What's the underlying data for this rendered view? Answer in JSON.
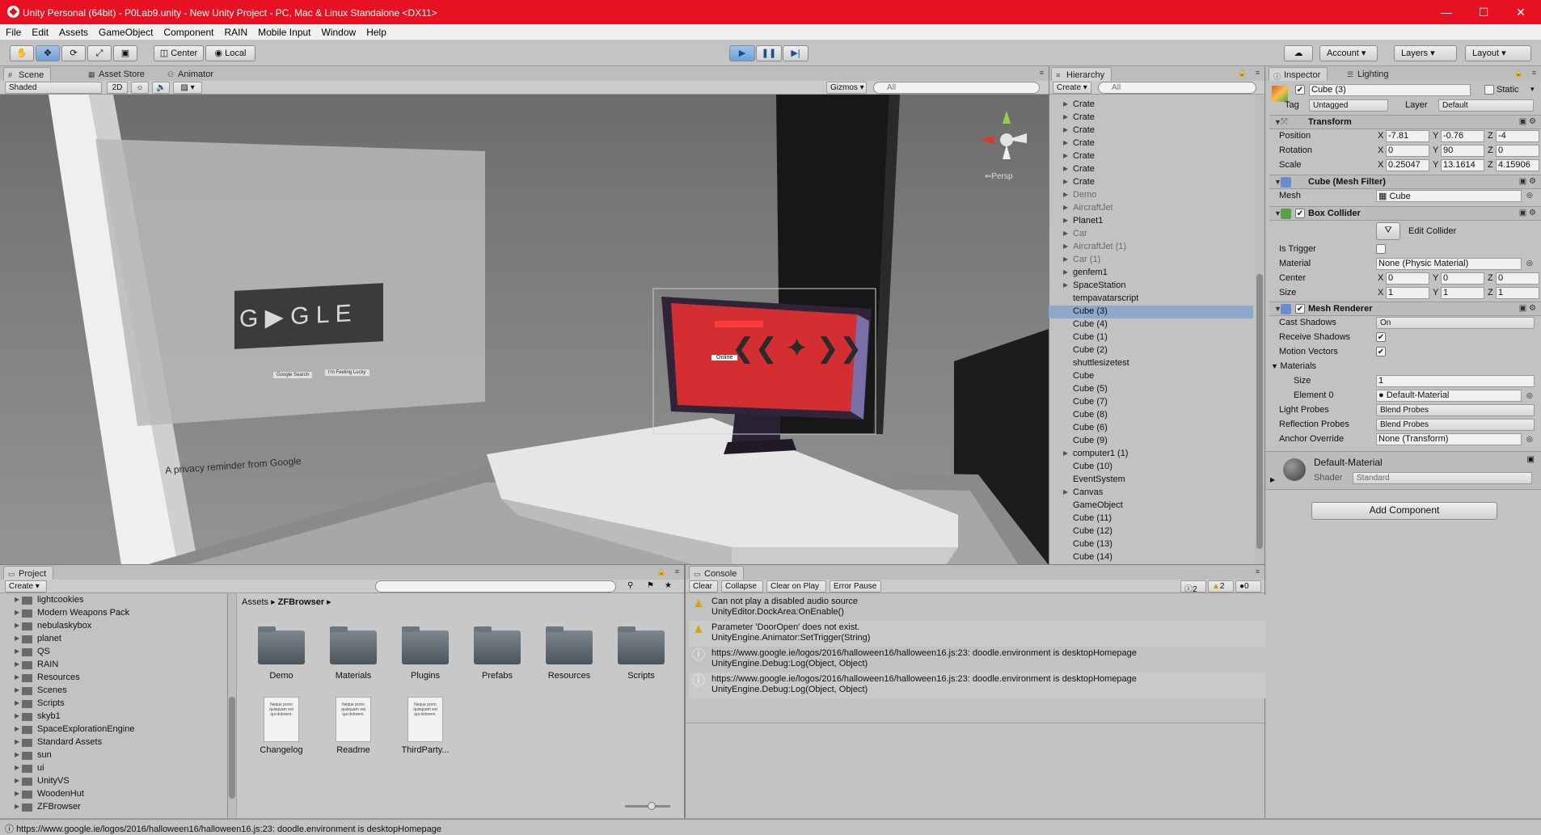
{
  "window": {
    "title": "Unity Personal (64bit) - P0Lab9.unity - New Unity Project - PC, Mac & Linux Standalone <DX11>",
    "controls": [
      "—",
      "☐",
      "✕"
    ]
  },
  "menu": [
    "File",
    "Edit",
    "Assets",
    "GameObject",
    "Component",
    "RAIN",
    "Mobile Input",
    "Window",
    "Help"
  ],
  "toolbar": {
    "pivot": "Center",
    "space": "Local",
    "account": "Account",
    "layers": "Layers",
    "layout": "Layout"
  },
  "scene": {
    "tabs": [
      "Scene",
      "Asset Store",
      "Animator"
    ],
    "shading": "Shaded",
    "mode2d": "2D",
    "gizmos": "Gizmos",
    "search_placeholder": "All",
    "persp": "Persp",
    "browser": {
      "privacy": "A privacy reminder from Google",
      "btn1": "Google Search",
      "btn2": "I'm Feeling Lucky"
    },
    "monitor": {
      "label": "Online"
    }
  },
  "hierarchy": {
    "tab": "Hierarchy",
    "create": "Create",
    "search_placeholder": "All",
    "items": [
      {
        "label": "Crate",
        "grey": false,
        "arrow": true
      },
      {
        "label": "Crate",
        "grey": false,
        "arrow": true
      },
      {
        "label": "Crate",
        "grey": false,
        "arrow": true
      },
      {
        "label": "Crate",
        "grey": false,
        "arrow": true
      },
      {
        "label": "Crate",
        "grey": false,
        "arrow": true
      },
      {
        "label": "Crate",
        "grey": false,
        "arrow": true
      },
      {
        "label": "Crate",
        "grey": false,
        "arrow": true
      },
      {
        "label": "Demo",
        "grey": true,
        "arrow": true
      },
      {
        "label": "AircraftJet",
        "grey": true,
        "arrow": true
      },
      {
        "label": "Planet1",
        "grey": false,
        "arrow": true
      },
      {
        "label": "Car",
        "grey": true,
        "arrow": true
      },
      {
        "label": "AircraftJet (1)",
        "grey": true,
        "arrow": true
      },
      {
        "label": "Car (1)",
        "grey": true,
        "arrow": true
      },
      {
        "label": "genfem1",
        "grey": false,
        "arrow": true
      },
      {
        "label": "SpaceStation",
        "grey": false,
        "arrow": true
      },
      {
        "label": "tempavatarscript",
        "grey": false,
        "arrow": false
      },
      {
        "label": "Cube (3)",
        "grey": false,
        "arrow": false
      },
      {
        "label": "Cube (4)",
        "grey": false,
        "arrow": false
      },
      {
        "label": "Cube (1)",
        "grey": false,
        "arrow": false
      },
      {
        "label": "Cube (2)",
        "grey": false,
        "arrow": false
      },
      {
        "label": "shuttlesizetest",
        "grey": false,
        "arrow": false
      },
      {
        "label": "Cube",
        "grey": false,
        "arrow": false
      },
      {
        "label": "Cube (5)",
        "grey": false,
        "arrow": false
      },
      {
        "label": "Cube (7)",
        "grey": false,
        "arrow": false
      },
      {
        "label": "Cube (8)",
        "grey": false,
        "arrow": false
      },
      {
        "label": "Cube (6)",
        "grey": false,
        "arrow": false
      },
      {
        "label": "Cube (9)",
        "grey": false,
        "arrow": false
      },
      {
        "label": "computer1 (1)",
        "grey": false,
        "arrow": true
      },
      {
        "label": "Cube (10)",
        "grey": false,
        "arrow": false
      },
      {
        "label": "EventSystem",
        "grey": false,
        "arrow": false
      },
      {
        "label": "Canvas",
        "grey": false,
        "arrow": true
      },
      {
        "label": "GameObject",
        "grey": false,
        "arrow": false
      },
      {
        "label": "Cube (11)",
        "grey": false,
        "arrow": false
      },
      {
        "label": "Cube (12)",
        "grey": false,
        "arrow": false
      },
      {
        "label": "Cube (13)",
        "grey": false,
        "arrow": false
      },
      {
        "label": "Cube (14)",
        "grey": false,
        "arrow": false
      }
    ]
  },
  "inspector": {
    "tabs": [
      "Inspector",
      "Lighting"
    ],
    "object_name": "Cube (3)",
    "static_label": "Static",
    "tag_label": "Tag",
    "tag_value": "Untagged",
    "layer_label": "Layer",
    "layer_value": "Default",
    "transform": {
      "title": "Transform",
      "position_label": "Position",
      "rotation_label": "Rotation",
      "scale_label": "Scale",
      "position": [
        "-7.81",
        "-0.76",
        "-4"
      ],
      "rotation": [
        "0",
        "90",
        "0"
      ],
      "scale": [
        "0.25047",
        "13.1614",
        "4.15906"
      ]
    },
    "mesh_filter": {
      "title": "Cube (Mesh Filter)",
      "mesh_label": "Mesh",
      "mesh_value": "Cube"
    },
    "box_collider": {
      "title": "Box Collider",
      "edit_label": "Edit Collider",
      "trigger_label": "Is Trigger",
      "material_label": "Material",
      "material_value": "None (Physic Material)",
      "center_label": "Center",
      "center": [
        "0",
        "0",
        "0"
      ],
      "size_label": "Size",
      "size": [
        "1",
        "1",
        "1"
      ]
    },
    "mesh_renderer": {
      "title": "Mesh Renderer",
      "cast_label": "Cast Shadows",
      "cast_value": "On",
      "receive_label": "Receive Shadows",
      "motion_label": "Motion Vectors",
      "materials_label": "Materials",
      "size_label": "Size",
      "size_value": "1",
      "element_label": "Element 0",
      "element_value": "Default-Material",
      "light_label": "Light Probes",
      "light_value": "Blend Probes",
      "reflection_label": "Reflection Probes",
      "reflection_value": "Blend Probes",
      "anchor_label": "Anchor Override",
      "anchor_value": "None (Transform)"
    },
    "material": {
      "name": "Default-Material",
      "shader_label": "Shader",
      "shader_value": "Standard"
    },
    "add_component": "Add Component"
  },
  "project": {
    "tab": "Project",
    "create": "Create",
    "folders": [
      "lightcookies",
      "Modern Weapons Pack",
      "nebulaskybox",
      "planet",
      "QS",
      "RAIN",
      "Resources",
      "Scenes",
      "Scripts",
      "skyb1",
      "SpaceExplorationEngine",
      "Standard Assets",
      "sun",
      "ui",
      "UnityVS",
      "WoodenHut",
      "ZFBrowser"
    ],
    "breadcrumb_root": "Assets",
    "breadcrumb_current": "ZFBrowser",
    "assets_folders": [
      "Demo",
      "Materials",
      "Plugins",
      "Prefabs",
      "Resources",
      "Scripts"
    ],
    "assets_files": [
      "Changelog",
      "Readme",
      "ThirdParty..."
    ],
    "doc_preview": "Neque porro quisquam est qui dolorem."
  },
  "console": {
    "tab": "Console",
    "buttons": [
      "Clear",
      "Collapse",
      "Clear on Play",
      "Error Pause"
    ],
    "counts": {
      "info": "2",
      "warn": "2",
      "error": "0"
    },
    "entries": [
      {
        "type": "warn",
        "line1": "Can not play a disabled audio source",
        "line2": "UnityEditor.DockArea:OnEnable()"
      },
      {
        "type": "warn",
        "line1": "Parameter 'DoorOpen' does not exist.",
        "line2": "UnityEngine.Animator:SetTrigger(String)"
      },
      {
        "type": "info",
        "line1": "https://www.google.ie/logos/2016/halloween16/halloween16.js:23: doodle.environment is desktopHomepage",
        "line2": "UnityEngine.Debug:Log(Object, Object)"
      },
      {
        "type": "info",
        "line1": "https://www.google.ie/logos/2016/halloween16/halloween16.js:23: doodle.environment is desktopHomepage",
        "line2": "UnityEngine.Debug:Log(Object, Object)"
      }
    ]
  },
  "status": "https://www.google.ie/logos/2016/halloween16/halloween16.js:23: doodle.environment is desktopHomepage",
  "colors": {
    "titlebar": "#e81123",
    "selection": "#8ea8cc",
    "editor_bg": "#c2c2c2"
  }
}
